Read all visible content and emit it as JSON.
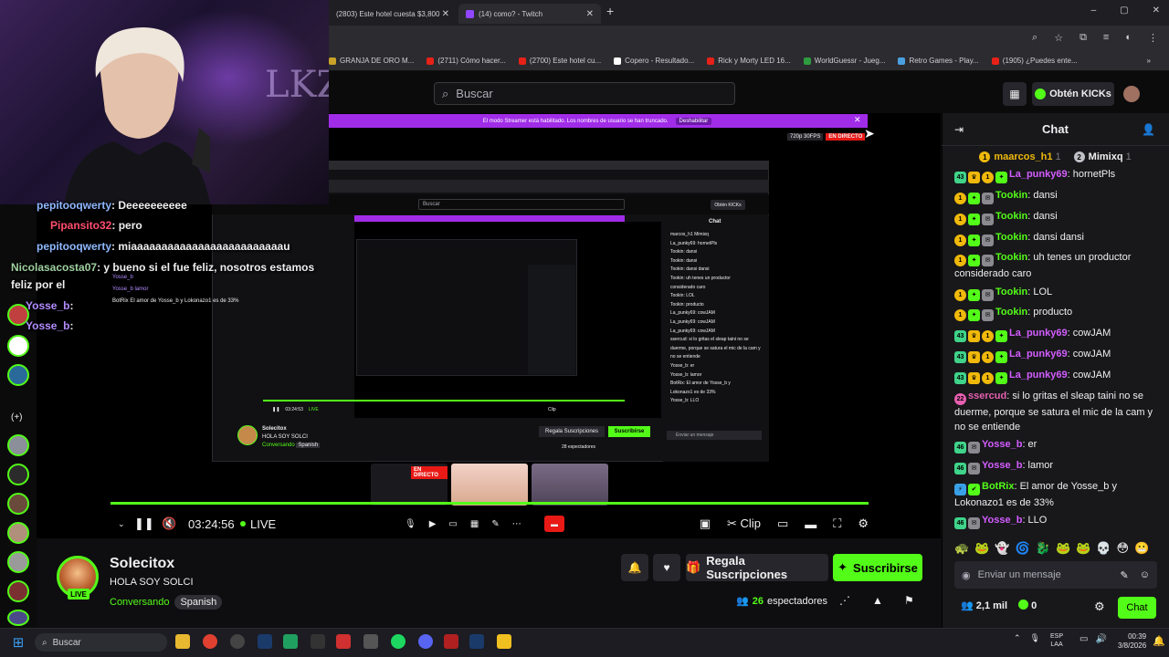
{
  "browser": {
    "tabs": [
      {
        "label": "(2803) Este hotel cuesta $3,800"
      },
      {
        "label": "(14) como? - Twitch"
      }
    ],
    "new_tab": "+",
    "window_controls": [
      "–",
      "▢",
      "✕"
    ],
    "bookmarks": [
      {
        "label": "GRANJA DE ORO M...",
        "color": "#c9a227"
      },
      {
        "label": "(2711) Cómo hacer...",
        "color": "#e62117"
      },
      {
        "label": "(2700) Este hotel cu...",
        "color": "#e62117"
      },
      {
        "label": "Copero - Resultado...",
        "color": "#ffffff"
      },
      {
        "label": "Rick y Morty LED 16...",
        "color": "#e62117"
      },
      {
        "label": "WorldGuessr - Jueg...",
        "color": "#2e9b3f"
      },
      {
        "label": "Retro Games - Play...",
        "color": "#4aa0e0"
      },
      {
        "label": "(1905) ¿Puedes ente...",
        "color": "#e62117"
      }
    ]
  },
  "header": {
    "search_placeholder": "Buscar",
    "kicks_label": "Obtén KICKs"
  },
  "webcam": {
    "neon_text": "LKZ"
  },
  "overlay_chat": [
    {
      "user": "pepitooqwerty",
      "text": ": Deeeeeeeeee",
      "color": "#8fb8ff"
    },
    {
      "user": "Pipansito32",
      "text": ": pero",
      "color": "#ff4d6d"
    },
    {
      "user": "pepitooqwerty",
      "text": ": miaaaaaaaaaaaaaaaaaaaaaaaaau",
      "color": "#8fb8ff"
    },
    {
      "user": "Nicolasacosta07",
      "text": ": y bueno si el fue feliz, nosotros estamos",
      "color": "#9fd0a0"
    },
    {
      "user": "",
      "text": "feliz por el",
      "color": "#ffffff"
    },
    {
      "user": "Yosse_b",
      "text": ":",
      "color": "#b28cff"
    },
    {
      "user": "Yosse_b",
      "text": ":",
      "color": "#b28cff"
    }
  ],
  "player": {
    "banner_text": "El modo Streamer está habilitado. Los nombres de usuario se han truncado.",
    "banner_button": "Deshabilitar",
    "quality": "720p 30FPS",
    "live_tag": "EN DIRECTO",
    "time": "03:24:56",
    "live_label": "LIVE",
    "clip_label": "Clip"
  },
  "nested": {
    "search": "Buscar",
    "kicks": "Obtén KICKs",
    "chat_title": "Chat",
    "streamer": "Solecitox",
    "title": "HOLA SOY SOLCI",
    "category": "Conversando",
    "tag": "Spanish",
    "gift": "Regala Suscripciones",
    "sub": "Suscribirse",
    "viewers": "28 espectadores",
    "time": "03:24:53",
    "live": "LIVE",
    "clip": "Clip",
    "thumb_live": "EN DIRECTO",
    "chat_lines": [
      "marcos_h1  Mimixq",
      "La_punky69: hornetPls",
      "Tookin: dansi",
      "Tookin: dansi",
      "Tookin: dansi dansi",
      "Tookin: uh tenes un productor",
      "considerado caro",
      "Tookin: LOL",
      "Tookin: producto",
      "La_punky69: cowJAM",
      "La_punky69: cowJAM",
      "La_punky69: cowJAM",
      "ssercud: si lo gritas el sleap taini no se",
      "duerme, porque se satura el mic de la cam y",
      "no se entiende",
      "Yosse_b: er",
      "Yosse_b: lamor",
      "BotRix: El amor de Yosse_b y",
      "Lokonazo1 es de 33%",
      "Yosse_b: LLO"
    ],
    "chat_input": "Enviar un mensaje",
    "left_chat": [
      "Yosse_b",
      "Yosse_b lamor",
      "BotRix El amor de Yosse_b y Lokonazo1 es de 33%"
    ]
  },
  "stream": {
    "name": "Solecitox",
    "title": "HOLA SOY SOLCI",
    "category": "Conversando",
    "tag": "Spanish",
    "live_badge": "LIVE",
    "gift_label": "Regala Suscripciones",
    "sub_label": "Suscribirse",
    "viewers_count": "26",
    "viewers_label": "espectadores"
  },
  "chat": {
    "title": "Chat",
    "pinned": [
      {
        "rank": "1",
        "user": "maarcos_h1",
        "count": "1",
        "color": "#f0b90b"
      },
      {
        "rank": "2",
        "user": "Mimixq",
        "count": "1",
        "color": "#c0c0c8"
      }
    ],
    "messages": [
      {
        "badges": [
          "43",
          "crown",
          "1",
          "star"
        ],
        "user": "La_punky69",
        "color": "#d35dff",
        "text": ": hornetPls"
      },
      {
        "badges": [
          "1",
          "star",
          "mod"
        ],
        "user": "Tookin",
        "color": "#53fc18",
        "text": ": dansi"
      },
      {
        "badges": [
          "1",
          "star",
          "mod"
        ],
        "user": "Tookin",
        "color": "#53fc18",
        "text": ": dansi"
      },
      {
        "badges": [
          "1",
          "star",
          "mod"
        ],
        "user": "Tookin",
        "color": "#53fc18",
        "text": ": dansi dansi"
      },
      {
        "badges": [
          "1",
          "star",
          "mod"
        ],
        "user": "Tookin",
        "color": "#53fc18",
        "text": ": uh tenes un productor considerado caro"
      },
      {
        "badges": [
          "1",
          "star",
          "mod"
        ],
        "user": "Tookin",
        "color": "#53fc18",
        "text": ": LOL"
      },
      {
        "badges": [
          "1",
          "star",
          "mod"
        ],
        "user": "Tookin",
        "color": "#53fc18",
        "text": ": producto"
      },
      {
        "badges": [
          "43",
          "crown",
          "1",
          "star"
        ],
        "user": "La_punky69",
        "color": "#d35dff",
        "text": ": cowJAM"
      },
      {
        "badges": [
          "43",
          "crown",
          "1",
          "star"
        ],
        "user": "La_punky69",
        "color": "#d35dff",
        "text": ": cowJAM"
      },
      {
        "badges": [
          "43",
          "crown",
          "1",
          "star"
        ],
        "user": "La_punky69",
        "color": "#d35dff",
        "text": ": cowJAM"
      },
      {
        "badges": [
          "22"
        ],
        "user": "ssercud",
        "color": "#e65fb0",
        "text": ": si lo gritas el sleap taini no se duerme, porque se satura el mic de la cam y no se entiende"
      },
      {
        "badges": [
          "46",
          "mod"
        ],
        "user": "Yosse_b",
        "color": "#d35dff",
        "text": ": er"
      },
      {
        "badges": [
          "46",
          "mod"
        ],
        "user": "Yosse_b",
        "color": "#d35dff",
        "text": ": lamor"
      },
      {
        "badges": [
          "bot",
          "check"
        ],
        "user": "BotRix",
        "color": "#53fc18",
        "text": ": El amor de Yosse_b y Lokonazo1 es de 33%"
      },
      {
        "badges": [
          "46",
          "mod"
        ],
        "user": "Yosse_b",
        "color": "#d35dff",
        "text": ": LLO"
      }
    ],
    "input_placeholder": "Enviar un mensaje",
    "followers": "2,1 mil",
    "kicks": "0",
    "send_label": "Chat"
  },
  "taskbar": {
    "search": "Buscar",
    "lang_top": "ESP",
    "lang_bottom": "LAA",
    "time": "00:39",
    "date": "3/8/2026"
  }
}
